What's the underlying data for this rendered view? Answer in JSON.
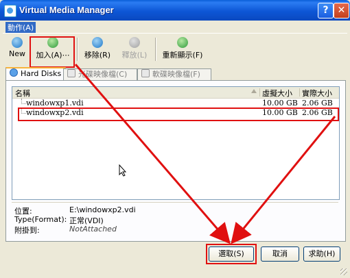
{
  "window": {
    "title": "Virtual Media Manager",
    "help_glyph": "?",
    "close_glyph": "✕"
  },
  "menu": {
    "action": "動作(A)"
  },
  "toolbar": {
    "new": "New",
    "add": "加入(A)⋯",
    "remove": "移除(R)",
    "release": "釋放(L)",
    "refresh": "重新顯示(F)"
  },
  "tabs": [
    {
      "label": "Hard Disks"
    },
    {
      "label": "光碟映像檔(C)"
    },
    {
      "label": "軟碟映像檔(F)"
    }
  ],
  "table": {
    "headers": {
      "name": "名稱",
      "virtual_size": "虛擬大小",
      "actual_size": "實際大小"
    },
    "rows": [
      {
        "name": "windowxp1.vdi",
        "virtual_size": "10.00 GB",
        "actual_size": "2.06 GB"
      },
      {
        "name": "windowxp2.vdi",
        "virtual_size": "10.00 GB",
        "actual_size": "2.06 GB"
      }
    ]
  },
  "details": {
    "location_label": "位置:",
    "location_value": "E:\\windowxp2.vdi",
    "type_label": "Type(Format):",
    "type_value": "正常(VDI)",
    "attached_label": "附掛到:",
    "attached_value": "NotAttached"
  },
  "buttons": {
    "select": "選取(S)",
    "cancel": "取消",
    "help": "求助(H)"
  },
  "colors": {
    "annotation_red": "#e01010",
    "titlebar_blue": "#0a5fd8"
  }
}
